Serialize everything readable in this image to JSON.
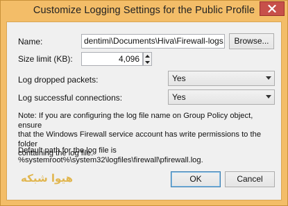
{
  "window": {
    "title": "Customize Logging Settings for the Public Profile"
  },
  "form": {
    "name_label": "Name:",
    "name_value": "dentimi\\Documents\\Hiva\\Firewall-logs.txt",
    "browse_label": "Browse...",
    "size_label": "Size limit (KB):",
    "size_value": "4,096",
    "dropped_label": "Log dropped packets:",
    "dropped_value": "Yes",
    "success_label": "Log successful connections:",
    "success_value": "Yes"
  },
  "note": {
    "line1": "Note: If you are configuring the log file name on Group Policy object, ensure",
    "line2": "that the Windows Firewall service account has write permissions to the folder",
    "line3": "containing the log file.",
    "default1": "Default path for the log file is",
    "default2": "%systemroot%\\system32\\logfiles\\firewall\\pfirewall.log."
  },
  "watermark_text": "هیوا شبکه",
  "buttons": {
    "ok_label": "OK",
    "cancel_label": "Cancel"
  },
  "colors": {
    "frame": "#f3bd68",
    "close": "#c7504a",
    "default_border": "#3c7fb1"
  },
  "icons": {
    "close": "close-icon",
    "spin_up": "spin-up-icon",
    "spin_down": "spin-down-icon",
    "dropdown": "chevron-down-icon"
  }
}
